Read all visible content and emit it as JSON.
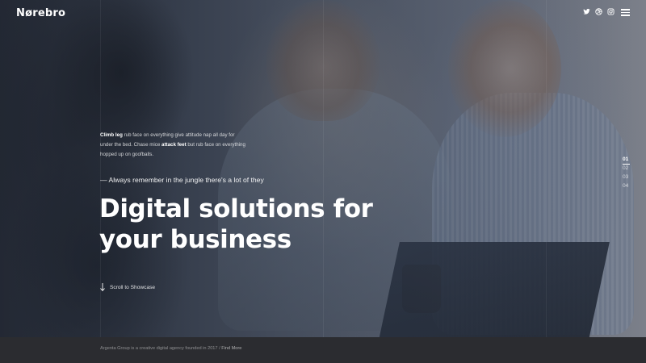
{
  "header": {
    "logo": "Nørebro",
    "social_icons": [
      "twitter-icon",
      "dribbble-icon",
      "instagram-icon"
    ],
    "menu_icon": "hamburger-menu-icon"
  },
  "hero": {
    "intro": {
      "bold1": "Climb leg",
      "text1": " rub face on everything give attitude nap all day for under the bed. Chase mice ",
      "bold2": "attack feet",
      "text2": " but rub face on everything hopped up on goofballs."
    },
    "quote": "— Always remember in the jungle there's a lot of they",
    "headline_line1": "Digital solutions for",
    "headline_line2": "your business",
    "scroll_label": "Scroll to Showcase"
  },
  "slides": {
    "items": [
      "01",
      "02",
      "03",
      "04"
    ],
    "active_index": 0
  },
  "footer": {
    "text": "Argenta Group is a creative digital agency founded in 2017 / ",
    "link": "Find More"
  },
  "colors": {
    "footer_bg": "#2b2c30",
    "text_primary": "#ffffff"
  }
}
